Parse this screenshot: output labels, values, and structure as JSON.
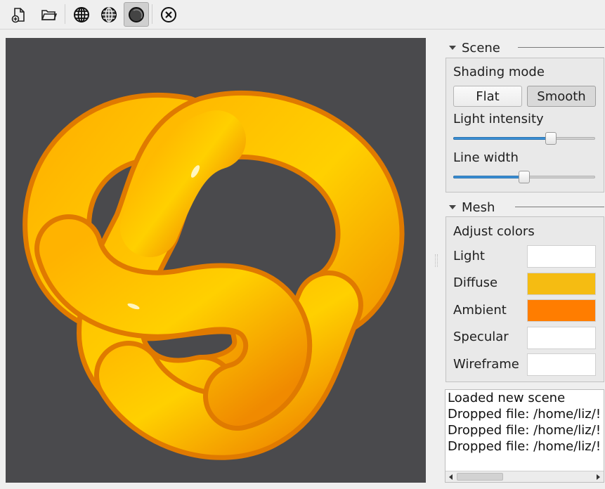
{
  "toolbar": {
    "buttons": [
      {
        "icon": "new-file-icon"
      },
      {
        "icon": "open-folder-icon"
      },
      {
        "icon": "wireframe-globe-icon"
      },
      {
        "icon": "wireframe-shaded-globe-icon"
      },
      {
        "icon": "shaded-sphere-icon",
        "active": true
      },
      {
        "icon": "close-circle-icon"
      }
    ]
  },
  "viewport": {
    "background": "#4a4a4d",
    "model": "trefoil-knot",
    "model_color": "#f7b500"
  },
  "scene": {
    "title": "Scene",
    "shading_label": "Shading mode",
    "flat_label": "Flat",
    "smooth_label": "Smooth",
    "selected_shading": "Smooth",
    "light_intensity_label": "Light intensity",
    "light_intensity_value": 0.69,
    "line_width_label": "Line width",
    "line_width_value": 0.5
  },
  "mesh": {
    "title": "Mesh",
    "adjust_label": "Adjust colors",
    "colors": [
      {
        "label": "Light",
        "color": "#ffffff"
      },
      {
        "label": "Diffuse",
        "color": "#f5bc12"
      },
      {
        "label": "Ambient",
        "color": "#ff7d00"
      },
      {
        "label": "Specular",
        "color": "#ffffff"
      },
      {
        "label": "Wireframe",
        "color": "#ffffff"
      }
    ]
  },
  "log": {
    "lines": [
      "Loaded new scene",
      "Dropped file: /home/liz/!",
      "Dropped file: /home/liz/!",
      "Dropped file: /home/liz/!"
    ]
  }
}
